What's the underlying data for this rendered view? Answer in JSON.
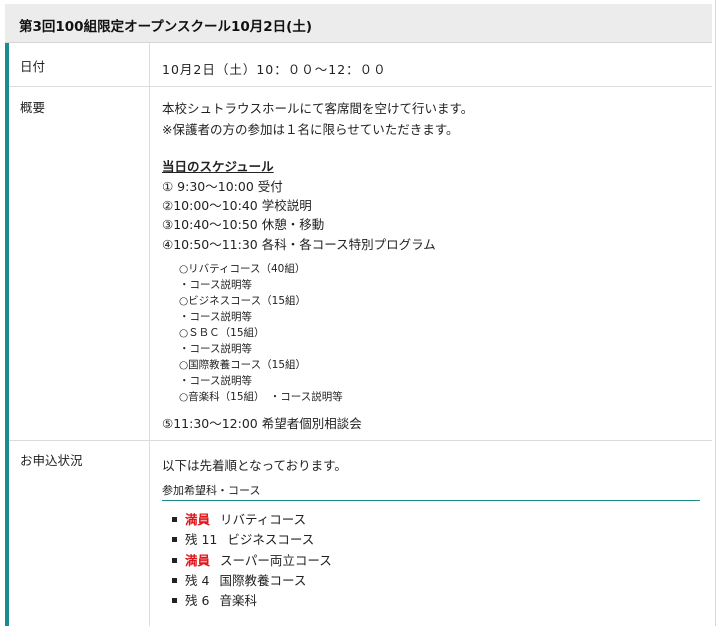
{
  "title": "第3回100組限定オープンスクール10月2日(土)",
  "rows": {
    "date": {
      "label": "日付",
      "value": "10月2日（土）10：００～12：００"
    },
    "overview": {
      "label": "概要",
      "lines": [
        "本校シュトラウスホールにて客席間を空けて行います。",
        "※保護者の方の参加は１名に限らせていただきます。"
      ],
      "schedule_heading": "当日のスケジュール",
      "schedule": [
        "① 9:30～10:00 受付",
        "②10:00～10:40 学校説明",
        "③10:40～10:50 休憩・移動",
        "④10:50～11:30 各科・各コース特別プログラム"
      ],
      "programs": [
        "○リバティコース（40組）",
        "・コース説明等",
        "○ビジネスコース（15組）",
        "・コース説明等",
        "○ＳＢＣ（15組）",
        "・コース説明等",
        "○国際教養コース（15組）",
        "・コース説明等",
        "○音楽科（15組）　・コース説明等"
      ],
      "last_item": "⑤11:30～12:00 希望者個別相談会"
    },
    "application": {
      "label": "お申込状況",
      "intro": "以下は先着順となっております。",
      "subheading": "参加希望科・コース",
      "items": [
        {
          "status": "満員",
          "full": true,
          "course": "リバティコース"
        },
        {
          "status": "残 11",
          "full": false,
          "course": "ビジネスコース"
        },
        {
          "status": "満員",
          "full": true,
          "course": "スーパー両立コース"
        },
        {
          "status": "残 4",
          "full": false,
          "course": "国際教養コース"
        },
        {
          "status": "残 6",
          "full": false,
          "course": "音楽科"
        }
      ]
    }
  },
  "colors": {
    "accent": "#1a8a8c",
    "full": "#e0161a",
    "header_bg": "#ececec"
  }
}
